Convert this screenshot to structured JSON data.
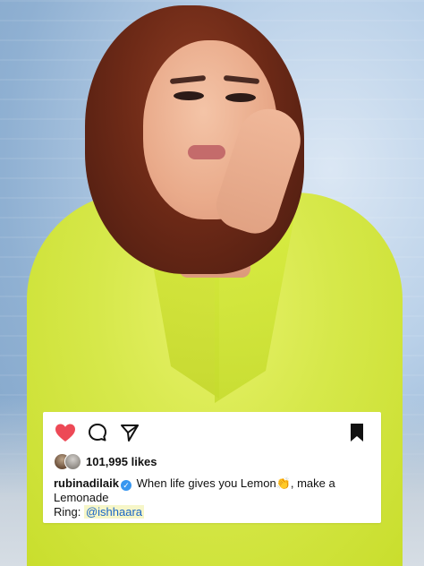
{
  "post": {
    "image_alt": "Woman wearing a bright yellow-green blazer against a light blue wall",
    "actions": {
      "like_icon": "heart-filled",
      "comment_icon": "speech-bubble",
      "share_icon": "paper-plane",
      "save_icon": "bookmark-filled",
      "like_color": "#ed4956"
    },
    "likes": {
      "count_text": "101,995 likes"
    },
    "caption": {
      "username": "rubinadilaik",
      "verified_mark": "✓",
      "line1": "When life gives you Lemon",
      "emoji": "👏",
      "line1_tail": ", make a",
      "line2": "Lemonade",
      "line3_prefix": "Ring: ",
      "mention": "@ishhaara"
    }
  }
}
